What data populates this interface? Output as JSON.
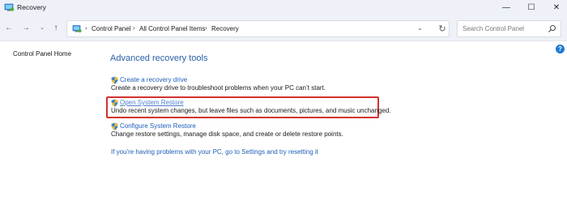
{
  "window": {
    "title": "Recovery",
    "icon": "control-panel-icon",
    "controls": {
      "minimize": "—",
      "maximize": "☐",
      "close": "✕"
    }
  },
  "navigation": {
    "back": "←",
    "forward": "→",
    "recent": "⌄",
    "up": "↑",
    "breadcrumb": [
      "Control Panel",
      "All Control Panel Items",
      "Recovery"
    ],
    "separator": "›",
    "dropdown": "⌄",
    "refresh": "↻",
    "search_placeholder": "Search Control Panel"
  },
  "left_pane": {
    "home_link": "Control Panel Home"
  },
  "main": {
    "heading": "Advanced recovery tools",
    "items": [
      {
        "label": "Create a recovery drive",
        "description": "Create a recovery drive to troubleshoot problems when your PC can’t start.",
        "icon": "shield-icon"
      },
      {
        "label": "Open System Restore",
        "description": "Undo recent system changes, but leave files such as documents, pictures, and music unchanged.",
        "icon": "shield-icon",
        "highlighted": true
      },
      {
        "label": "Configure System Restore",
        "description": "Change restore settings, manage disk space, and create or delete restore points.",
        "icon": "shield-icon"
      }
    ],
    "reset_link": "If you're having problems with your PC, go to Settings and try resetting it"
  },
  "colors": {
    "accent": "#2a5fa6",
    "link": "#1d5fb8",
    "highlight_border": "#d3322e",
    "chrome_bg": "#eef2f8"
  }
}
